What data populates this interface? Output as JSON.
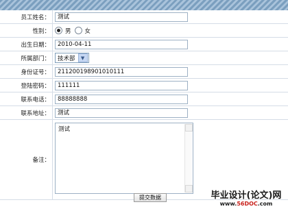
{
  "form": {
    "name": {
      "label": "员工姓名：",
      "value": "测试"
    },
    "gender": {
      "label": "性别：",
      "options": [
        "男",
        "女"
      ],
      "selected": "男"
    },
    "birthday": {
      "label": "出生日期：",
      "value": "2010-04-11"
    },
    "department": {
      "label": "所属部门：",
      "value": "技术部"
    },
    "id_number": {
      "label": "身份证号：",
      "value": "211200198901010111"
    },
    "password": {
      "label": "登陆密码：",
      "value": "111111"
    },
    "phone": {
      "label": "联系电话：",
      "value": "88888888"
    },
    "address": {
      "label": "联系地址：",
      "value": "测试"
    },
    "remark": {
      "label": "备注：",
      "value": "测试"
    },
    "submit_label": "提交数据"
  },
  "watermark": {
    "main": "毕业设计(论文)网",
    "sub_prefix": "www.",
    "sub_highlight": "56DOC",
    "sub_suffix": ".com"
  }
}
